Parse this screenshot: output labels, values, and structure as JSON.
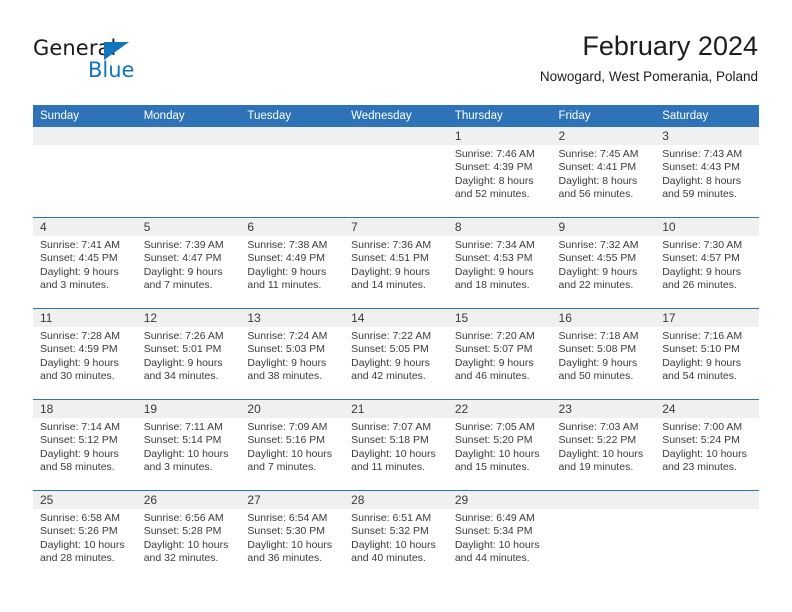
{
  "brand": {
    "name_top": "General",
    "name_bottom": "Blue",
    "accent_color": "#1275bd"
  },
  "header": {
    "title": "February 2024",
    "subtitle": "Nowogard, West Pomerania, Poland"
  },
  "theme": {
    "header_blue": "#2E73B8",
    "daynum_bg": "#f0f0f0",
    "text": "#3a3a3a"
  },
  "weekday_headers": [
    "Sunday",
    "Monday",
    "Tuesday",
    "Wednesday",
    "Thursday",
    "Friday",
    "Saturday"
  ],
  "weeks": [
    [
      {
        "day": "",
        "lines": []
      },
      {
        "day": "",
        "lines": []
      },
      {
        "day": "",
        "lines": []
      },
      {
        "day": "",
        "lines": []
      },
      {
        "day": "1",
        "lines": [
          "Sunrise: 7:46 AM",
          "Sunset: 4:39 PM",
          "Daylight: 8 hours",
          "and 52 minutes."
        ]
      },
      {
        "day": "2",
        "lines": [
          "Sunrise: 7:45 AM",
          "Sunset: 4:41 PM",
          "Daylight: 8 hours",
          "and 56 minutes."
        ]
      },
      {
        "day": "3",
        "lines": [
          "Sunrise: 7:43 AM",
          "Sunset: 4:43 PM",
          "Daylight: 8 hours",
          "and 59 minutes."
        ]
      }
    ],
    [
      {
        "day": "4",
        "lines": [
          "Sunrise: 7:41 AM",
          "Sunset: 4:45 PM",
          "Daylight: 9 hours",
          "and 3 minutes."
        ]
      },
      {
        "day": "5",
        "lines": [
          "Sunrise: 7:39 AM",
          "Sunset: 4:47 PM",
          "Daylight: 9 hours",
          "and 7 minutes."
        ]
      },
      {
        "day": "6",
        "lines": [
          "Sunrise: 7:38 AM",
          "Sunset: 4:49 PM",
          "Daylight: 9 hours",
          "and 11 minutes."
        ]
      },
      {
        "day": "7",
        "lines": [
          "Sunrise: 7:36 AM",
          "Sunset: 4:51 PM",
          "Daylight: 9 hours",
          "and 14 minutes."
        ]
      },
      {
        "day": "8",
        "lines": [
          "Sunrise: 7:34 AM",
          "Sunset: 4:53 PM",
          "Daylight: 9 hours",
          "and 18 minutes."
        ]
      },
      {
        "day": "9",
        "lines": [
          "Sunrise: 7:32 AM",
          "Sunset: 4:55 PM",
          "Daylight: 9 hours",
          "and 22 minutes."
        ]
      },
      {
        "day": "10",
        "lines": [
          "Sunrise: 7:30 AM",
          "Sunset: 4:57 PM",
          "Daylight: 9 hours",
          "and 26 minutes."
        ]
      }
    ],
    [
      {
        "day": "11",
        "lines": [
          "Sunrise: 7:28 AM",
          "Sunset: 4:59 PM",
          "Daylight: 9 hours",
          "and 30 minutes."
        ]
      },
      {
        "day": "12",
        "lines": [
          "Sunrise: 7:26 AM",
          "Sunset: 5:01 PM",
          "Daylight: 9 hours",
          "and 34 minutes."
        ]
      },
      {
        "day": "13",
        "lines": [
          "Sunrise: 7:24 AM",
          "Sunset: 5:03 PM",
          "Daylight: 9 hours",
          "and 38 minutes."
        ]
      },
      {
        "day": "14",
        "lines": [
          "Sunrise: 7:22 AM",
          "Sunset: 5:05 PM",
          "Daylight: 9 hours",
          "and 42 minutes."
        ]
      },
      {
        "day": "15",
        "lines": [
          "Sunrise: 7:20 AM",
          "Sunset: 5:07 PM",
          "Daylight: 9 hours",
          "and 46 minutes."
        ]
      },
      {
        "day": "16",
        "lines": [
          "Sunrise: 7:18 AM",
          "Sunset: 5:08 PM",
          "Daylight: 9 hours",
          "and 50 minutes."
        ]
      },
      {
        "day": "17",
        "lines": [
          "Sunrise: 7:16 AM",
          "Sunset: 5:10 PM",
          "Daylight: 9 hours",
          "and 54 minutes."
        ]
      }
    ],
    [
      {
        "day": "18",
        "lines": [
          "Sunrise: 7:14 AM",
          "Sunset: 5:12 PM",
          "Daylight: 9 hours",
          "and 58 minutes."
        ]
      },
      {
        "day": "19",
        "lines": [
          "Sunrise: 7:11 AM",
          "Sunset: 5:14 PM",
          "Daylight: 10 hours",
          "and 3 minutes."
        ]
      },
      {
        "day": "20",
        "lines": [
          "Sunrise: 7:09 AM",
          "Sunset: 5:16 PM",
          "Daylight: 10 hours",
          "and 7 minutes."
        ]
      },
      {
        "day": "21",
        "lines": [
          "Sunrise: 7:07 AM",
          "Sunset: 5:18 PM",
          "Daylight: 10 hours",
          "and 11 minutes."
        ]
      },
      {
        "day": "22",
        "lines": [
          "Sunrise: 7:05 AM",
          "Sunset: 5:20 PM",
          "Daylight: 10 hours",
          "and 15 minutes."
        ]
      },
      {
        "day": "23",
        "lines": [
          "Sunrise: 7:03 AM",
          "Sunset: 5:22 PM",
          "Daylight: 10 hours",
          "and 19 minutes."
        ]
      },
      {
        "day": "24",
        "lines": [
          "Sunrise: 7:00 AM",
          "Sunset: 5:24 PM",
          "Daylight: 10 hours",
          "and 23 minutes."
        ]
      }
    ],
    [
      {
        "day": "25",
        "lines": [
          "Sunrise: 6:58 AM",
          "Sunset: 5:26 PM",
          "Daylight: 10 hours",
          "and 28 minutes."
        ]
      },
      {
        "day": "26",
        "lines": [
          "Sunrise: 6:56 AM",
          "Sunset: 5:28 PM",
          "Daylight: 10 hours",
          "and 32 minutes."
        ]
      },
      {
        "day": "27",
        "lines": [
          "Sunrise: 6:54 AM",
          "Sunset: 5:30 PM",
          "Daylight: 10 hours",
          "and 36 minutes."
        ]
      },
      {
        "day": "28",
        "lines": [
          "Sunrise: 6:51 AM",
          "Sunset: 5:32 PM",
          "Daylight: 10 hours",
          "and 40 minutes."
        ]
      },
      {
        "day": "29",
        "lines": [
          "Sunrise: 6:49 AM",
          "Sunset: 5:34 PM",
          "Daylight: 10 hours",
          "and 44 minutes."
        ]
      },
      {
        "day": "",
        "lines": []
      },
      {
        "day": "",
        "lines": []
      }
    ]
  ]
}
